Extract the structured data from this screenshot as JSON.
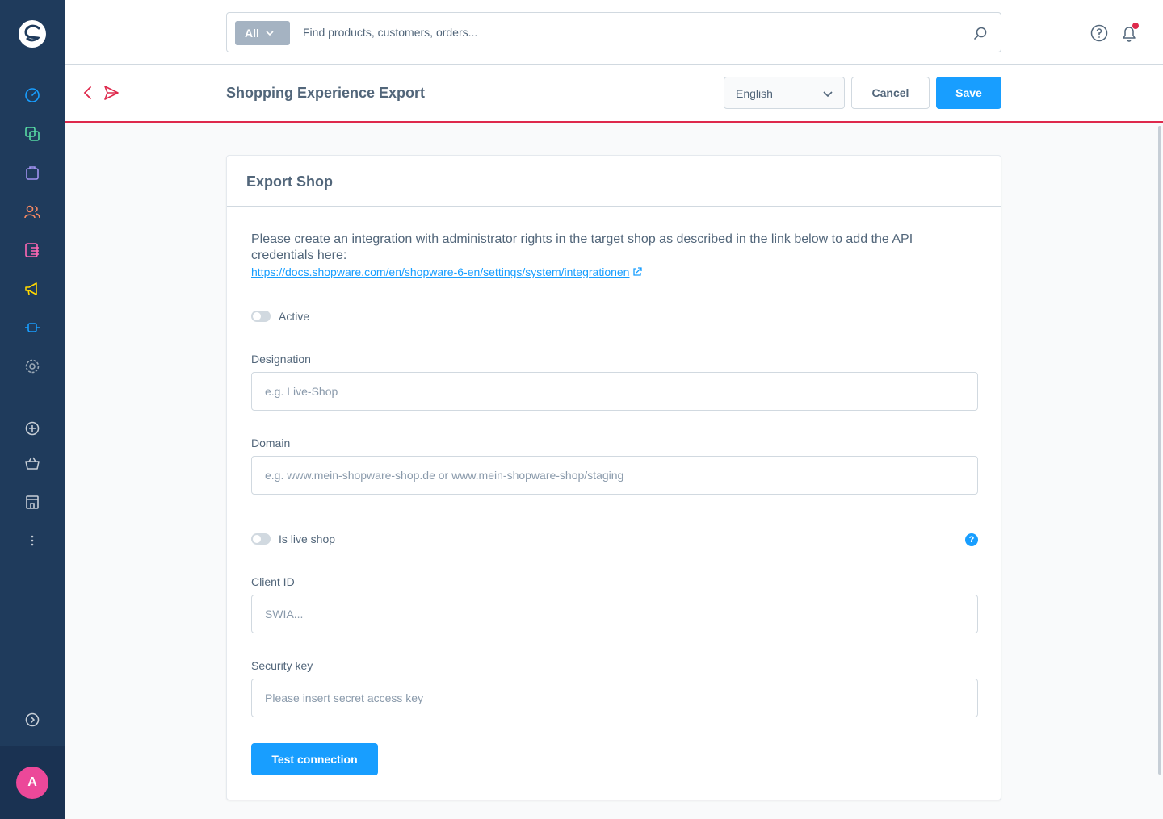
{
  "sidebar": {
    "items": [
      {
        "name": "dashboard-icon",
        "color": "#57d9a3"
      },
      {
        "name": "catalogue-icon",
        "color": "#57d9a3"
      },
      {
        "name": "orders-icon",
        "color": "#a092f0"
      },
      {
        "name": "customers-icon",
        "color": "#f88962"
      },
      {
        "name": "content-icon",
        "color": "#ff68b4"
      },
      {
        "name": "marketing-icon",
        "color": "#ffd700"
      },
      {
        "name": "extensions-icon",
        "color": "#189eff"
      },
      {
        "name": "settings-icon",
        "color": "#9aa8b5"
      }
    ],
    "avatar_initial": "A"
  },
  "topbar": {
    "search_scope": "All",
    "search_placeholder": "Find products, customers, orders..."
  },
  "header": {
    "title": "Shopping Experience Export",
    "language": "English",
    "cancel_label": "Cancel",
    "save_label": "Save"
  },
  "card": {
    "title": "Export Shop",
    "intro": "Please create an integration with administrator rights in the target shop as described in the link below to add the API credentials here:",
    "link": "https://docs.shopware.com/en/shopware-6-en/settings/system/integrationen",
    "active_label": "Active",
    "designation_label": "Designation",
    "designation_placeholder": "e.g. Live-Shop",
    "domain_label": "Domain",
    "domain_placeholder": "e.g. www.mein-shopware-shop.de or www.mein-shopware-shop/staging",
    "live_shop_label": "Is live shop",
    "help_glyph": "?",
    "client_id_label": "Client ID",
    "client_id_placeholder": "SWIA...",
    "security_key_label": "Security key",
    "security_key_placeholder": "Please insert secret access key",
    "test_button_label": "Test connection"
  },
  "colors": {
    "accent": "#189eff",
    "sidebar": "#1f3b5c",
    "alert": "#de294c"
  }
}
